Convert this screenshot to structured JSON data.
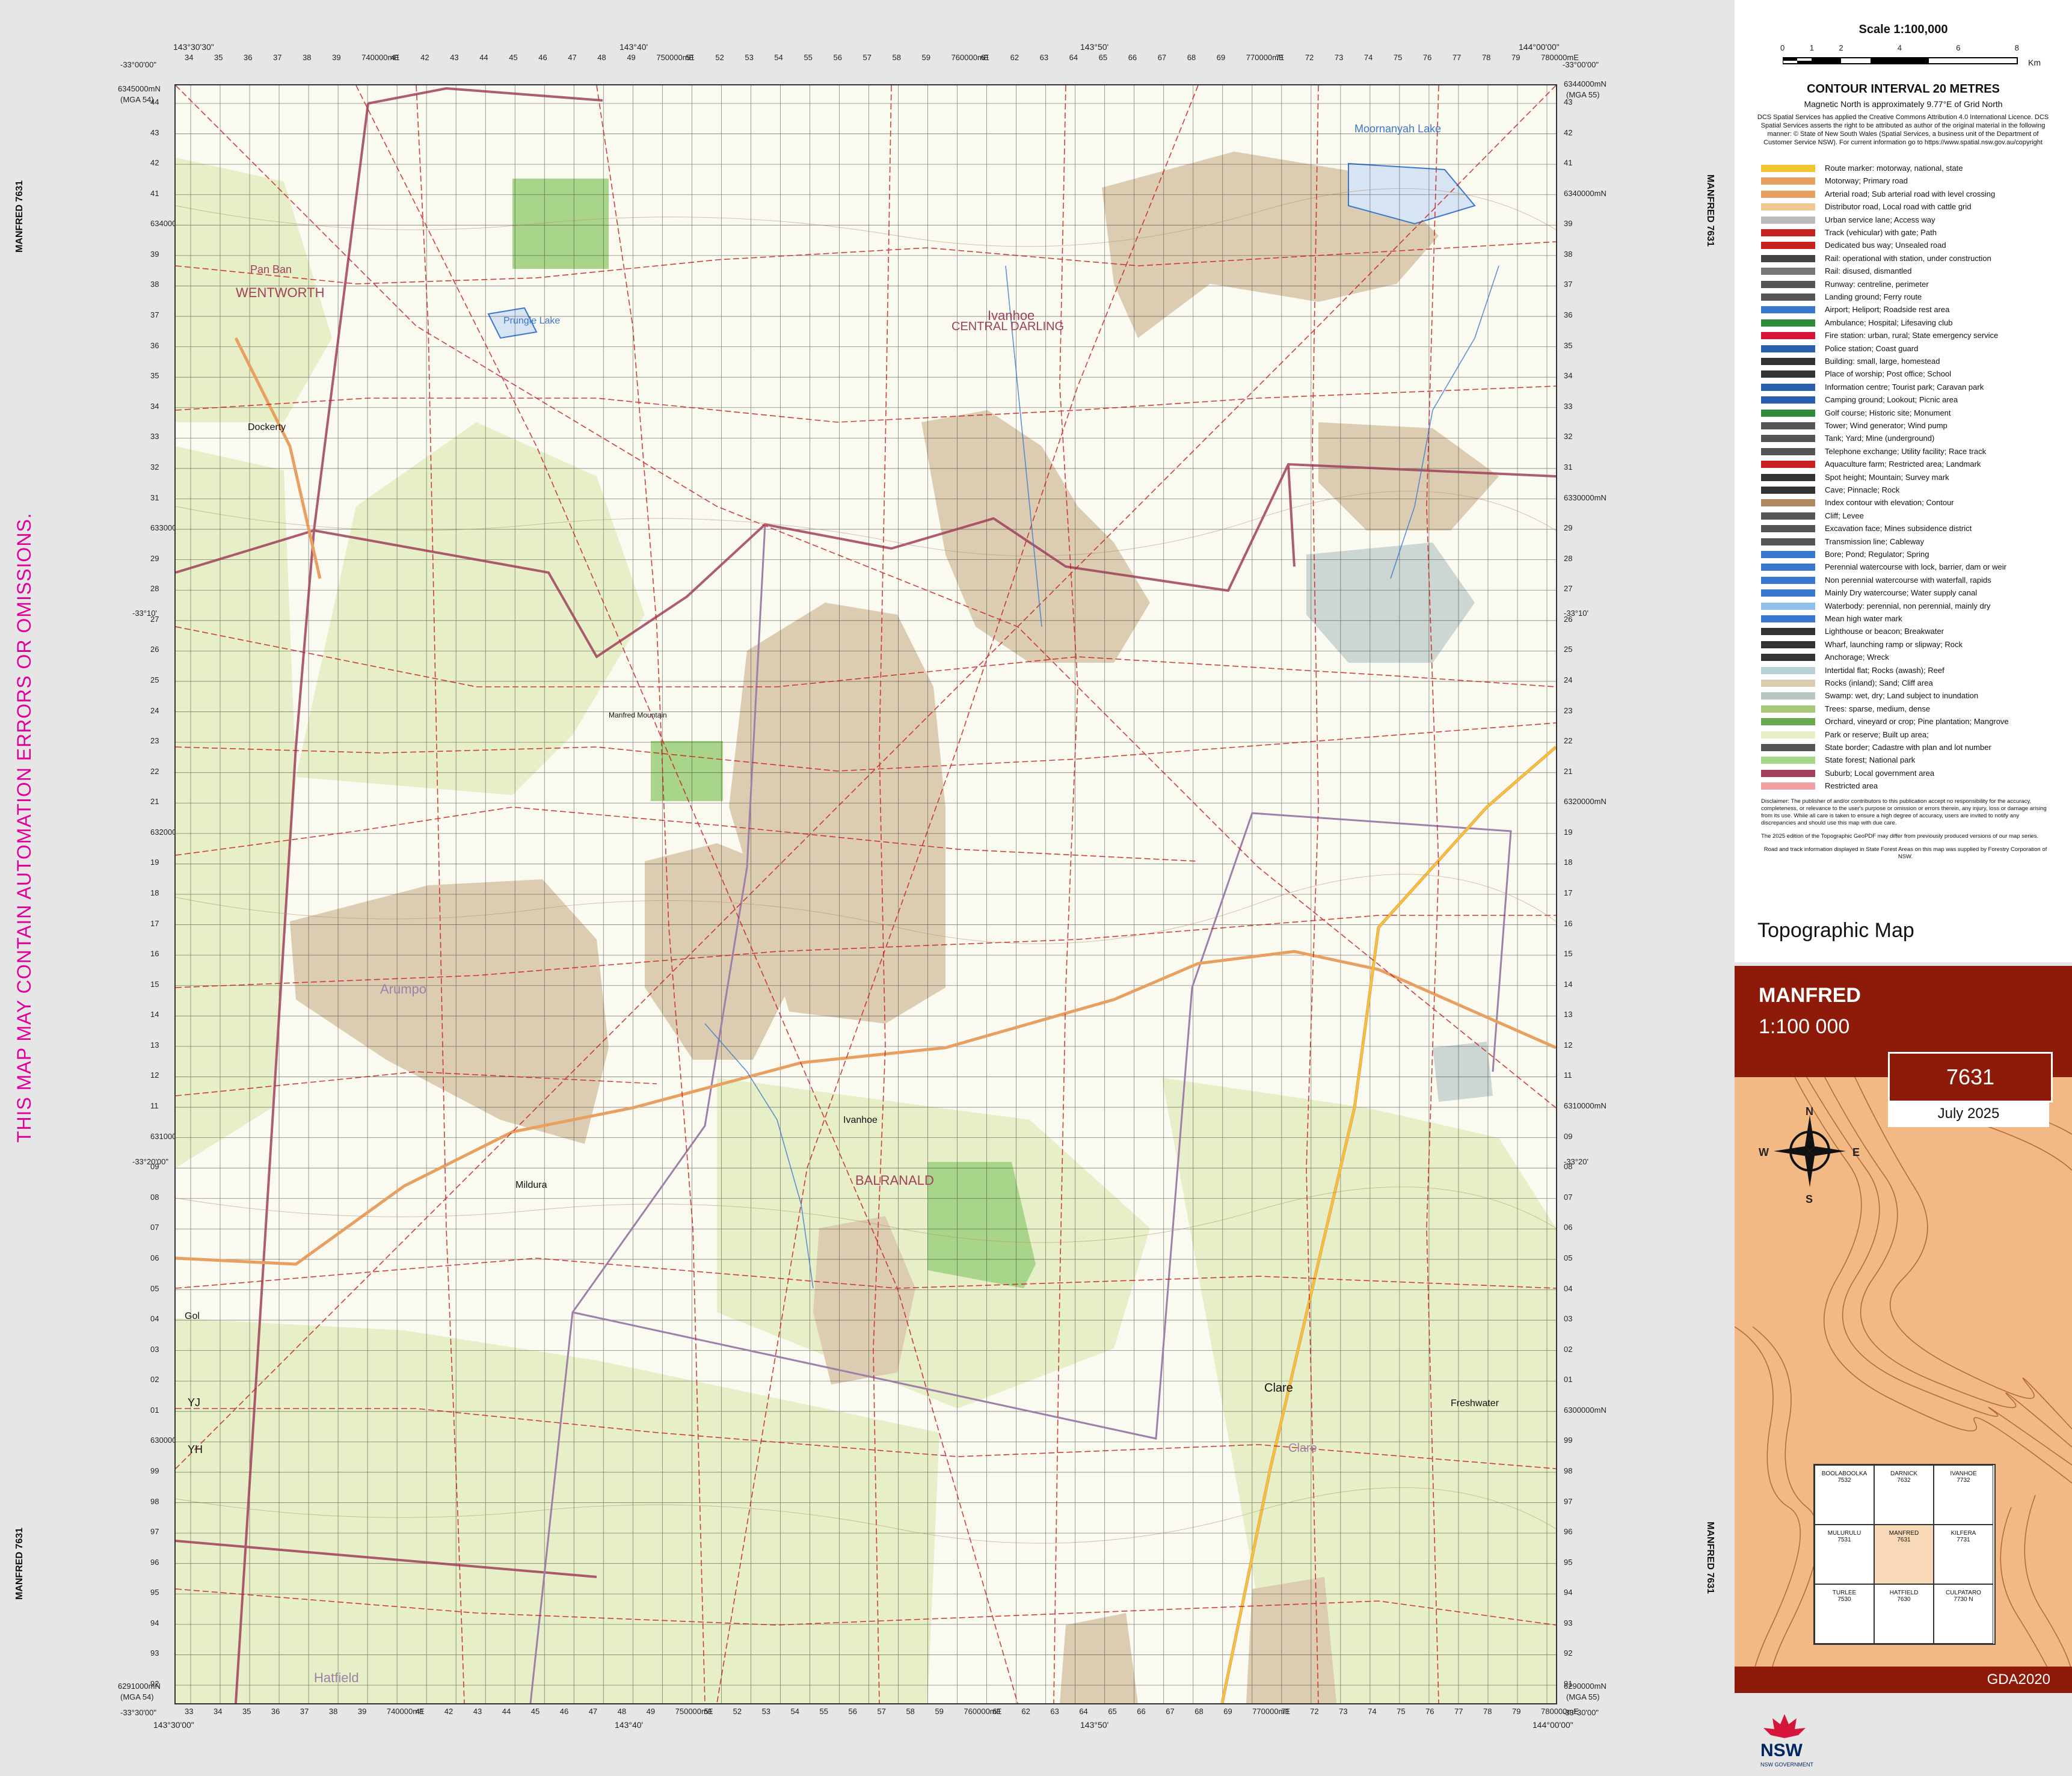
{
  "warning": "THIS MAP MAY CONTAIN AUTOMATION ERRORS OR OMISSIONS.",
  "side_labels": {
    "left_top": "MANFRED 7631",
    "left_bottom": "MANFRED 7631",
    "right_top": "MANFRED 7631",
    "right_bottom": "MANFRED 7631"
  },
  "corners": {
    "tl_lon": "143°30'30\"",
    "tl_lat": "-33°00'00\"",
    "tr_lon": "144°00'00\"",
    "tr_lat": "-33°00'00\"",
    "bl_lon": "143°30'00\"",
    "bl_lat": "-33°30'00\"",
    "br_lon": "144°00'00\"",
    "br_lat": "-33°30'00\"",
    "tl_north": "6345000mN",
    "tl_mga": "(MGA 54)",
    "tr_north": "6344000mN",
    "tr_mga": "(MGA 55)",
    "bl_north": "6291000mN",
    "bl_mga": "(MGA 54)",
    "br_north": "6290000mN",
    "br_mga": "(MGA 55)"
  },
  "top_ticks": [
    "34",
    "35",
    "36",
    "37",
    "38",
    "39",
    "740000mE",
    "41",
    "42",
    "43",
    "44",
    "45",
    "46",
    "47",
    "48",
    "49",
    "750000mE",
    "51",
    "52",
    "53",
    "54",
    "55",
    "56",
    "57",
    "58",
    "59",
    "760000mE",
    "61",
    "62",
    "63",
    "64",
    "65",
    "66",
    "67",
    "68",
    "69",
    "770000mE",
    "71",
    "72",
    "73",
    "74",
    "75",
    "76",
    "77",
    "78",
    "79",
    "780000mE"
  ],
  "bottom_ticks": [
    "33",
    "34",
    "35",
    "36",
    "37",
    "38",
    "39",
    "740000mE",
    "41",
    "42",
    "43",
    "44",
    "45",
    "46",
    "47",
    "48",
    "49",
    "750000mE",
    "51",
    "52",
    "53",
    "54",
    "55",
    "56",
    "57",
    "58",
    "59",
    "760000mE",
    "61",
    "62",
    "63",
    "64",
    "65",
    "66",
    "67",
    "68",
    "69",
    "770000mE",
    "71",
    "72",
    "73",
    "74",
    "75",
    "76",
    "77",
    "78",
    "79",
    "780000mE"
  ],
  "left_ticks": [
    "44",
    "43",
    "42",
    "41",
    "6340000mN",
    "39",
    "38",
    "37",
    "36",
    "35",
    "34",
    "33",
    "32",
    "31",
    "6330000mN",
    "29",
    "28",
    "27",
    "26",
    "25",
    "24",
    "23",
    "22",
    "21",
    "6320000mN",
    "19",
    "18",
    "17",
    "16",
    "15",
    "14",
    "13",
    "12",
    "11",
    "6310000mN",
    "09",
    "08",
    "07",
    "06",
    "05",
    "04",
    "03",
    "02",
    "01",
    "6300000mN",
    "99",
    "98",
    "97",
    "96",
    "95",
    "94",
    "93",
    "92"
  ],
  "right_ticks": [
    "43",
    "42",
    "41",
    "6340000mN",
    "39",
    "38",
    "37",
    "36",
    "35",
    "34",
    "33",
    "32",
    "31",
    "6330000mN",
    "29",
    "28",
    "27",
    "26",
    "25",
    "24",
    "23",
    "22",
    "21",
    "6320000mN",
    "19",
    "18",
    "17",
    "16",
    "15",
    "14",
    "13",
    "12",
    "11",
    "6310000mN",
    "09",
    "08",
    "07",
    "06",
    "05",
    "04",
    "03",
    "02",
    "01",
    "6300000mN",
    "99",
    "98",
    "97",
    "96",
    "95",
    "94",
    "93",
    "92",
    "91"
  ],
  "mid_lats": {
    "left_a": "-33°10'",
    "left_b": "-33°20'00\"",
    "right_a": "-33°10'",
    "right_b": "-33°20'"
  },
  "mid_lons": {
    "top_a": "143°40'",
    "top_b": "143°50'",
    "bottom_a": "143°40'",
    "bottom_b": "143°50'"
  },
  "places": {
    "ivanhoe": "Ivanhoe",
    "wentworth": "WENTWORTH",
    "central_darling": "CENTRAL DARLING",
    "balranald": "BALRANALD",
    "arumpo": "Arumpo",
    "clare": "Clare",
    "hatfield": "Hatfield",
    "pan_ban": "Pan Ban",
    "moornanyah_lake": "Moornanyah Lake",
    "prungle_lake": "Prungle Lake",
    "gol_gol": "Gol",
    "manfred_mountain": "Manfred Mountain",
    "road_mildura": "Mildura",
    "road_ivanhoe": "Ivanhoe",
    "road_freshwater": "Freshwater",
    "road_dockerty": "Dockerty",
    "yj": "YJ",
    "yh": "YH"
  },
  "legend": {
    "scale_title": "Scale 1:100,000",
    "scale_ticks": [
      "0",
      "1",
      "2",
      "4",
      "6",
      "8"
    ],
    "scale_unit": "Km",
    "contour_interval": "CONTOUR INTERVAL 20 METRES",
    "magnetic": "Magnetic North is approximately 9.77°E of Grid North",
    "copyright": "DCS Spatial Services has applied the Creative Commons Attribution 4.0 International Licence. DCS Spatial Services asserts the right to be attributed as author of the original material in the following manner: © State of New South Wales (Spatial Services, a business unit of the Department of Customer Service NSW). For current information go to https://www.spatial.nsw.gov.au/copyright",
    "items": [
      "Route marker: motorway, national, state",
      "Motorway; Primary road",
      "Arterial road; Sub arterial road with level crossing",
      "Distributor road, Local road with cattle grid",
      "Urban service lane; Access way",
      "Track (vehicular) with gate; Path",
      "Dedicated bus way; Unsealed road",
      "Rail: operational with station, under construction",
      "Rail: disused, dismantled",
      "Runway: centreline, perimeter",
      "Landing ground; Ferry route",
      "Airport; Heliport; Roadside rest area",
      "Ambulance; Hospital; Lifesaving club",
      "Fire station: urban, rural; State emergency service",
      "Police station; Coast guard",
      "Building: small, large, homestead",
      "Place of worship; Post office; School",
      "Information centre; Tourist park; Caravan park",
      "Camping ground; Lookout; Picnic area",
      "Golf course; Historic site; Monument",
      "Tower; Wind generator; Wind pump",
      "Tank; Yard; Mine (underground)",
      "Telephone exchange; Utility facility; Race track",
      "Aquaculture farm; Restricted area; Landmark",
      "Spot height; Mountain; Survey mark",
      "Cave; Pinnacle; Rock",
      "Index contour with elevation; Contour",
      "Cliff; Levee",
      "Excavation face; Mines subsidence district",
      "Transmission line; Cableway",
      "Bore; Pond; Regulator; Spring",
      "Perennial watercourse with lock, barrier, dam or weir",
      "Non perennial watercourse with waterfall, rapids",
      "Mainly Dry watercourse; Water supply canal",
      "Waterbody: perennial, non perennial, mainly dry",
      "Mean high water mark",
      "Lighthouse or beacon; Breakwater",
      "Wharf, launching ramp or slipway; Rock",
      "Anchorage; Wreck",
      "Intertidal flat; Rocks (awash); Reef",
      "Rocks (inland); Sand; Cliff area",
      "Swamp: wet, dry; Land subject to inundation",
      "Trees: sparse, medium, dense",
      "Orchard, vineyard or crop; Pine plantation; Mangrove",
      "Park or reserve; Built up area;",
      "State border; Cadastre with plan and lot number",
      "State forest; National park",
      "Suburb; Local government area",
      "Restricted area"
    ],
    "disclaimer": "Disclaimer: The publisher of and/or contributors to this publication accept no responsibility for the accuracy, completeness, or relevance to the user's purpose or omission or errors therein, any injury, loss or damage arising from its use. While all care is taken to ensure a high degree of accuracy, users are invited to notify any discrepancies and should use this map with due care.",
    "edition_note": "The 2025 edition of the Topographic GeoPDF may differ from previously produced versions of our map series.",
    "forestry_note": "Road and track information displayed in State Forest Areas on this map was supplied by Forestry Corporation of NSW."
  },
  "title_block": {
    "topo_title": "Topographic Map",
    "map_name": "MANFRED",
    "map_scale": "1:100 000",
    "sheet_number": "7631",
    "date": "July 2025",
    "datum": "GDA2020",
    "compass": {
      "n": "N",
      "s": "S",
      "e": "E",
      "w": "W"
    },
    "index": [
      {
        "name": "BOOLABOOLKA",
        "num": "7532"
      },
      {
        "name": "DARNICK",
        "num": "7632"
      },
      {
        "name": "IVANHOE",
        "num": "7732"
      },
      {
        "name": "MULURULU",
        "num": "7531"
      },
      {
        "name": "MANFRED",
        "num": "7631"
      },
      {
        "name": "KILFERA",
        "num": "7731"
      },
      {
        "name": "TURLEE",
        "num": "7530"
      },
      {
        "name": "HATFIELD",
        "num": "7630"
      },
      {
        "name": "CULPATARO",
        "num": "7730 N"
      }
    ],
    "logo_text": "NSW GOVERNMENT"
  },
  "colors": {
    "sand": "#d9c9ae",
    "forest": "#e6efc6",
    "park": "#a8d58a",
    "road_orange": "#e8a060",
    "road_red": "#c62020",
    "lga_border": "#a0405a",
    "water": "#3a78d0",
    "banner": "#8e1b0a",
    "warning": "#e0009c"
  }
}
